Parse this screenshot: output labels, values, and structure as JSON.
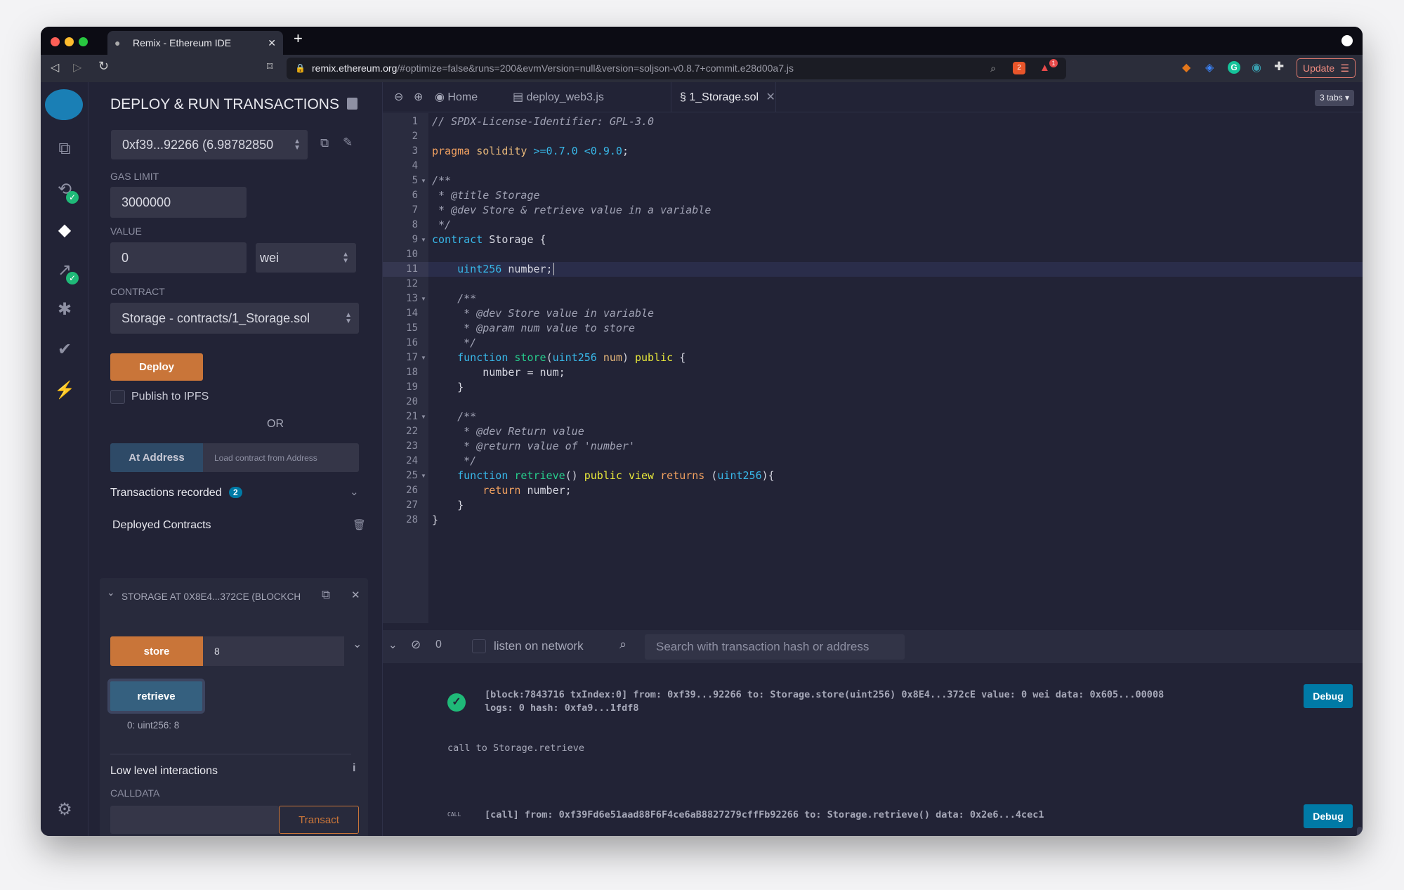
{
  "browser": {
    "tab_title": "Remix - Ethereum IDE",
    "url_host": "remix.ethereum.org",
    "url_rest": "/#optimize=false&runs=200&evmVersion=null&version=soljson-v0.8.7+commit.e28d00a7.js",
    "update_label": "Update",
    "brave_badge": "2",
    "rewards_badge": "1"
  },
  "panel": {
    "title": "DEPLOY & RUN TRANSACTIONS",
    "account": "0xf39...92266 (6.98782850",
    "gas_limit_label": "GAS LIMIT",
    "gas_limit": "3000000",
    "value_label": "VALUE",
    "value": "0",
    "unit": "wei",
    "contract_label": "CONTRACT",
    "contract": "Storage - contracts/1_Storage.sol",
    "deploy_label": "Deploy",
    "publish_label": "Publish to IPFS",
    "or_label": "OR",
    "at_address_label": "At Address",
    "load_placeholder": "Load contract from Address",
    "tx_recorded_label": "Transactions recorded",
    "tx_recorded_count": "2",
    "deployed_label": "Deployed Contracts",
    "instance_title": "STORAGE AT 0X8E4...372CE (BLOCKCH",
    "store_label": "store",
    "store_value": "8",
    "retrieve_label": "retrieve",
    "retrieve_result": "0: uint256: 8",
    "low_level_label": "Low level interactions",
    "calldata_label": "CALLDATA",
    "transact_label": "Transact"
  },
  "editor": {
    "tabs": [
      {
        "label": "Home"
      },
      {
        "label": "deploy_web3.js"
      },
      {
        "label": "1_Storage.sol",
        "active": true
      }
    ],
    "tabs_count": "3 tabs",
    "active_line": 11,
    "lines": [
      [
        [
          "c",
          "// SPDX-License-Identifier: GPL-3.0"
        ]
      ],
      [],
      [
        [
          "o",
          "pragma"
        ],
        [
          "n",
          " "
        ],
        [
          "p",
          "solidity"
        ],
        [
          "n",
          " "
        ],
        [
          "b",
          ">=0.7.0 <0.9.0"
        ],
        [
          "n",
          ";"
        ]
      ],
      [],
      [
        [
          "c",
          "/**"
        ]
      ],
      [
        [
          "c",
          " * @title Storage"
        ]
      ],
      [
        [
          "c",
          " * @dev Store & retrieve value in a variable"
        ]
      ],
      [
        [
          "c",
          " */"
        ]
      ],
      [
        [
          "b",
          "contract"
        ],
        [
          "n",
          " Storage {"
        ]
      ],
      [],
      [
        [
          "n",
          "    "
        ],
        [
          "b",
          "uint256"
        ],
        [
          "n",
          " number;"
        ]
      ],
      [],
      [
        [
          "c",
          "    /**"
        ]
      ],
      [
        [
          "c",
          "     * @dev Store value in variable"
        ]
      ],
      [
        [
          "c",
          "     * @param num value to store"
        ]
      ],
      [
        [
          "c",
          "     */"
        ]
      ],
      [
        [
          "n",
          "    "
        ],
        [
          "b",
          "function"
        ],
        [
          "n",
          " "
        ],
        [
          "g",
          "store"
        ],
        [
          "n",
          "("
        ],
        [
          "b",
          "uint256"
        ],
        [
          "n",
          " "
        ],
        [
          "p",
          "num"
        ],
        [
          "n",
          ") "
        ],
        [
          "y",
          "public"
        ],
        [
          "n",
          " {"
        ]
      ],
      [
        [
          "n",
          "        number = num;"
        ]
      ],
      [
        [
          "n",
          "    }"
        ]
      ],
      [],
      [
        [
          "c",
          "    /**"
        ]
      ],
      [
        [
          "c",
          "     * @dev Return value"
        ]
      ],
      [
        [
          "c",
          "     * @return value of 'number'"
        ]
      ],
      [
        [
          "c",
          "     */"
        ]
      ],
      [
        [
          "n",
          "    "
        ],
        [
          "b",
          "function"
        ],
        [
          "n",
          " "
        ],
        [
          "g",
          "retrieve"
        ],
        [
          "n",
          "() "
        ],
        [
          "y",
          "public"
        ],
        [
          "n",
          " "
        ],
        [
          "y",
          "view"
        ],
        [
          "n",
          " "
        ],
        [
          "o",
          "returns"
        ],
        [
          "n",
          " ("
        ],
        [
          "b",
          "uint256"
        ],
        [
          "n",
          "){"
        ]
      ],
      [
        [
          "n",
          "        "
        ],
        [
          "o",
          "return"
        ],
        [
          "n",
          " number;"
        ]
      ],
      [
        [
          "n",
          "    }"
        ]
      ],
      [
        [
          "n",
          "}"
        ]
      ]
    ],
    "fold_lines": [
      5,
      9,
      13,
      17,
      21,
      25
    ]
  },
  "terminal": {
    "pending_count": "0",
    "listen_label": "listen on network",
    "search_placeholder": "Search with transaction hash or address",
    "log1_line1": "[block:7843716 txIndex:0] from: 0xf39...92266 to: Storage.store(uint256) 0x8E4...372cE value: 0 wei data: 0x605...00008",
    "log1_line2": "logs: 0 hash: 0xfa9...1fdf8",
    "call_note": "call to Storage.retrieve",
    "call_tag": "CALL",
    "log2": "[call] from: 0xf39Fd6e51aad88F6F4ce6aB8827279cffFb92266 to: Storage.retrieve() data: 0x2e6...4cec1",
    "debug_label": "Debug",
    "prompt": ">"
  },
  "colors": {
    "accent_orange": "#c97539",
    "accent_blue": "#007aa6",
    "success": "#1fb978",
    "bg": "#222336"
  }
}
